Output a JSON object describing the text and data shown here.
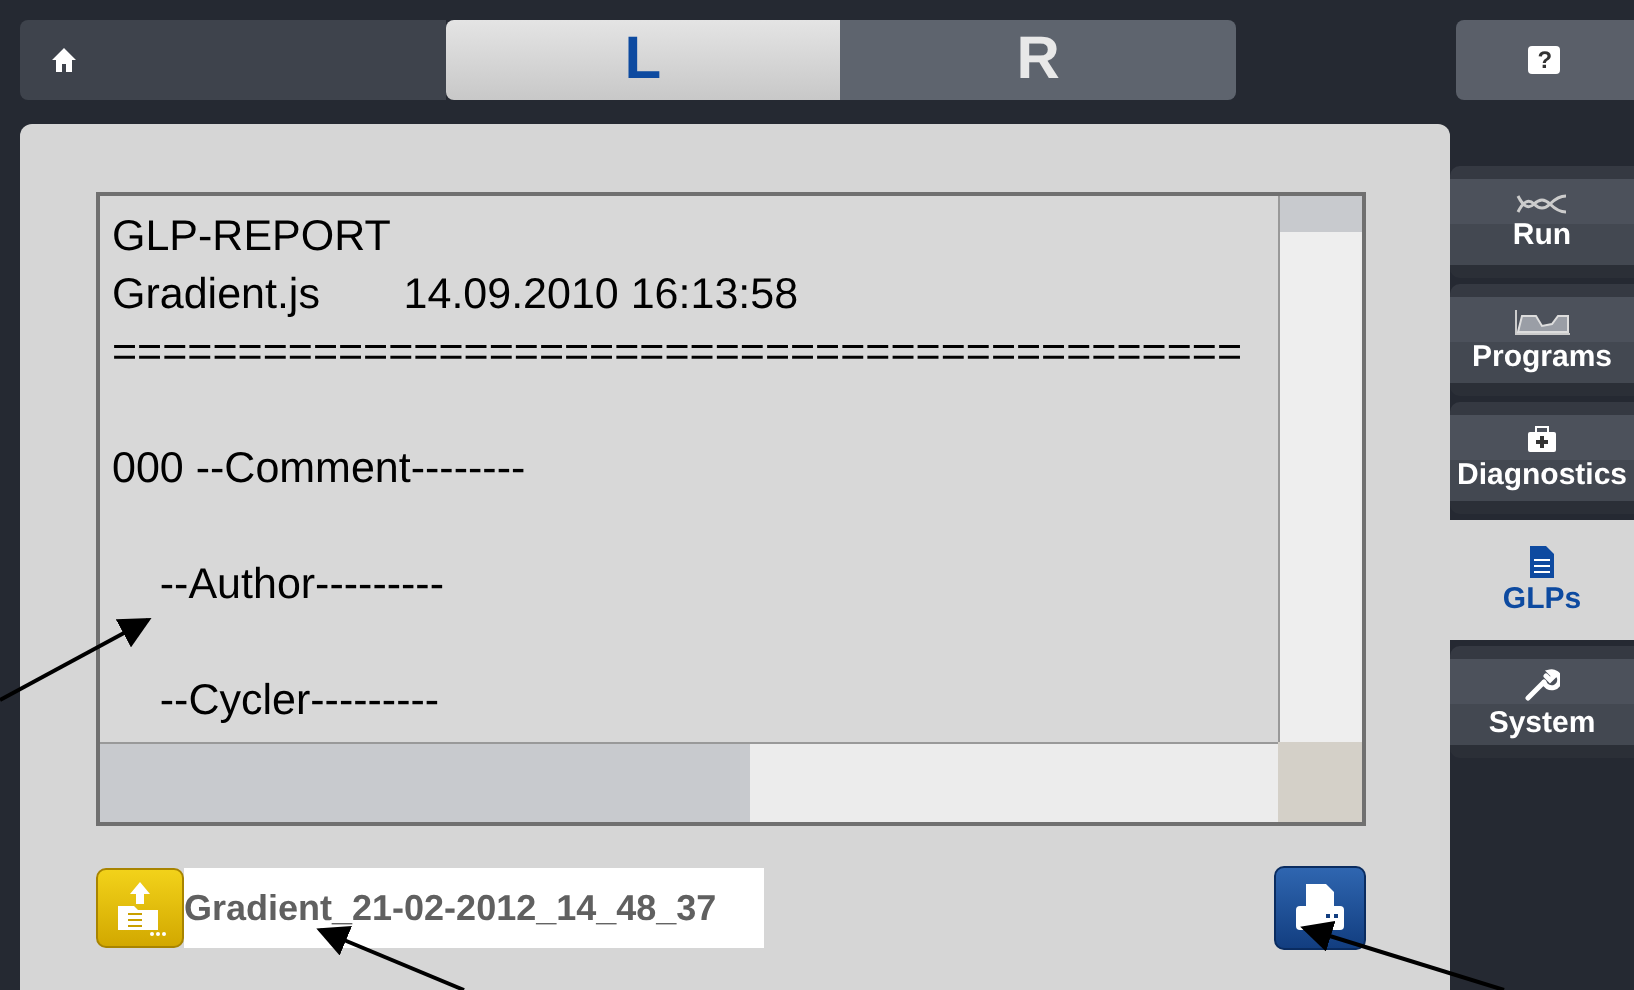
{
  "tabs": [
    {
      "label": "L",
      "selected": true
    },
    {
      "label": "R",
      "selected": false
    }
  ],
  "report": {
    "sections": [
      {
        "lines": [
          "GLP-REPORT",
          "Gradient.js       14.09.2010 16:13:58",
          "============================================="
        ]
      },
      {
        "lines": [
          "000 --Comment--------"
        ]
      },
      {
        "lines": [
          "    --Author---------"
        ]
      },
      {
        "lines": [
          "    --Cycler---------"
        ]
      }
    ]
  },
  "file": {
    "name": "Gradient_21-02-2012_14_48_37"
  },
  "help": {
    "label": "?"
  },
  "nav": [
    {
      "label": "Run",
      "kind": "helix",
      "selected": false
    },
    {
      "label": "Programs",
      "kind": "graph",
      "selected": false
    },
    {
      "label": "Diagnostics",
      "kind": "kit",
      "selected": false
    },
    {
      "label": "GLPs",
      "kind": "document",
      "selected": true
    },
    {
      "label": "System",
      "kind": "wrench",
      "selected": false
    }
  ]
}
